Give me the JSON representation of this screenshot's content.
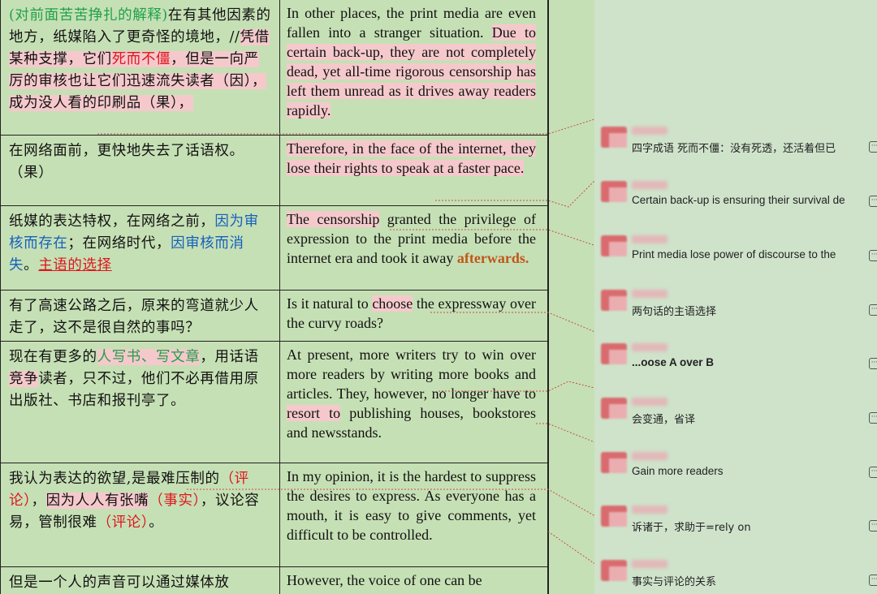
{
  "rows": [
    {
      "cn": [
        {
          "t": "(对前面苦苦挣扎的解释)",
          "c": "green"
        },
        {
          "t": "在有其他因素的地方，纸媒陷入了更奇怪的境地，//"
        },
        {
          "t": "凭借某种支撑，它们",
          "c": "hl"
        },
        {
          "t": "死而不僵",
          "c": "red hl"
        },
        {
          "t": "，但是一向严厉的审核也让它们迅速流失读者（因），成为没人看的印刷品（果），",
          "c": "hl"
        }
      ],
      "en": [
        {
          "t": "In other places, the print media are even fallen into a stranger situation. "
        },
        {
          "t": "Due to certain back-up, they are not completely dead, yet all-time rigorous censorship has left them unread as it drives away readers rapidly.",
          "c": "hl"
        }
      ]
    },
    {
      "cn": [
        {
          "t": "在网络面前，更快地失去了话语权。（果）"
        }
      ],
      "en": [
        {
          "t": "Therefore, in the face of the internet, they lose their rights to speak at a faster pace.",
          "c": "hl"
        }
      ]
    },
    {
      "cn": [
        {
          "t": "纸媒的表达特权，在网络之前，"
        },
        {
          "t": "因为审核而存在",
          "c": "blue"
        },
        {
          "t": "；在网络时代，"
        },
        {
          "t": "因审核而消失",
          "c": "blue"
        },
        {
          "t": "。"
        },
        {
          "t": "主语的选择",
          "c": "red uline"
        }
      ],
      "en": [
        {
          "t": "The censorship",
          "c": "hl"
        },
        {
          "t": " granted the privilege of expression to the print media before the internet era and took it away "
        },
        {
          "t": "afterwards.",
          "c": "orange"
        }
      ]
    },
    {
      "cn": [
        {
          "t": "有了高速公路之后，原来的弯道就少人走了，这不是很自然的事吗？"
        }
      ],
      "en": [
        {
          "t": "Is it natural to "
        },
        {
          "t": "choose",
          "c": "hl"
        },
        {
          "t": " the expressway over the curvy roads?"
        }
      ]
    },
    {
      "cn": [
        {
          "t": "现在有更多的"
        },
        {
          "t": "人写书、写文章",
          "c": "green hl"
        },
        {
          "t": "，用话语"
        },
        {
          "t": "竞争",
          "c": "hl"
        },
        {
          "t": "读者，只不过，他们不必再借用原出版社、书店和报刊亭了。"
        }
      ],
      "en": [
        {
          "t": "At present, more writers try to win over more readers by writing more books and articles. They, however, no longer have to "
        },
        {
          "t": "resort to",
          "c": "hl"
        },
        {
          "t": " publishing houses, bookstores and newsstands."
        }
      ]
    },
    {
      "cn": [
        {
          "t": "我认为表达的欲望,是最难压制的"
        },
        {
          "t": "（评论）",
          "c": "red"
        },
        {
          "t": "，"
        },
        {
          "t": "因为人人有张嘴",
          "c": "hl"
        },
        {
          "t": "（事实）",
          "c": "red"
        },
        {
          "t": "，议论容易，管制很难"
        },
        {
          "t": "（评论）",
          "c": "red"
        },
        {
          "t": "。"
        }
      ],
      "en": [
        {
          "t": "In my opinion, it is the hardest to suppress the desires to express. As everyone has a mouth, it is easy to give comments, yet difficult to be controlled."
        }
      ]
    },
    {
      "cn": [
        {
          "t": "但是一个人的声音可以通过媒体放"
        }
      ],
      "en": [
        {
          "t": "However, the voice of one can be"
        }
      ]
    }
  ],
  "comments": [
    {
      "text": "四字成语  死而不僵：没有死透，还活着但已"
    },
    {
      "text": "Certain back-up is ensuring their survival de"
    },
    {
      "text": "Print media lose power of discourse to the"
    },
    {
      "text": "两句话的主语选择"
    },
    {
      "text": "...oose A over B"
    },
    {
      "text": "会变通，省译"
    },
    {
      "text": "Gain more readers"
    },
    {
      "text": "诉诸于，求助于=rely on"
    },
    {
      "text": "事实与评论的关系"
    }
  ],
  "icons": {
    "comment_more": "ellipsis-icon"
  }
}
